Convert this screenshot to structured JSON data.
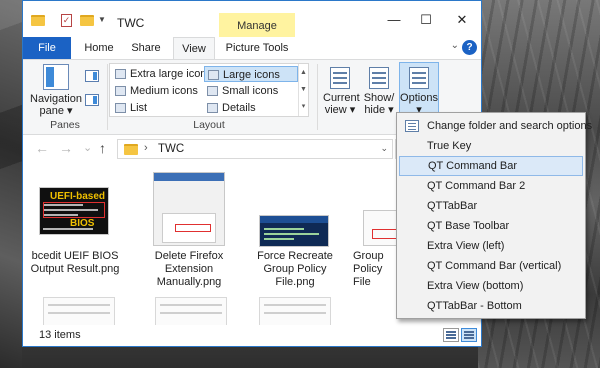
{
  "window": {
    "title": "TWC",
    "manage_label": "Manage",
    "minimize_glyph": "—",
    "maximize_glyph": "☐",
    "close_glyph": "✕"
  },
  "tabs": {
    "file": "File",
    "home": "Home",
    "share": "Share",
    "view": "View",
    "picture_tools": "Picture Tools"
  },
  "ribbon": {
    "panes": {
      "navigation_pane": "Navigation",
      "navigation_pane_line2": "pane ▾",
      "group_label": "Panes"
    },
    "layout": {
      "group_label": "Layout",
      "items": [
        "Extra large icons",
        "Large icons",
        "Medium icons",
        "Small icons",
        "List",
        "Details"
      ],
      "selected": "Large icons"
    },
    "current_view": {
      "line1": "Current",
      "line2": "view ▾"
    },
    "show_hide": {
      "line1": "Show/",
      "line2": "hide ▾"
    },
    "options": {
      "line1": "Options",
      "line2": "▾"
    }
  },
  "address": {
    "path": "TWC",
    "back_glyph": "←",
    "forward_glyph": "→",
    "recent_glyph": "⌄",
    "up_glyph": "↑",
    "refresh_glyph": "↻"
  },
  "files": [
    {
      "label": "bcedit UEIF BIOS Output Result.png",
      "thumb_text_1": "UEFI-based",
      "thumb_text_2": "BIOS"
    },
    {
      "label": "Delete Firefox Extension Manually.png"
    },
    {
      "label": "Force Recreate Group Policy File.png"
    },
    {
      "label": "Group Policy File"
    }
  ],
  "status": {
    "item_count": "13 items"
  },
  "options_menu": {
    "items": [
      "Change folder and search options",
      "True Key",
      "QT Command Bar",
      "QT Command Bar 2",
      "QTTabBar",
      "QT Base Toolbar",
      "Extra View (left)",
      "QT Command Bar (vertical)",
      "Extra View (bottom)",
      "QTTabBar - Bottom"
    ],
    "highlighted": "QT Command Bar",
    "first_item_icon": "folder-options-icon"
  },
  "colors": {
    "accent": "#1b62c4",
    "manage_tab": "#fff3a0",
    "selection": "#cde3f7",
    "menu_hover": "#dbe9f8"
  }
}
